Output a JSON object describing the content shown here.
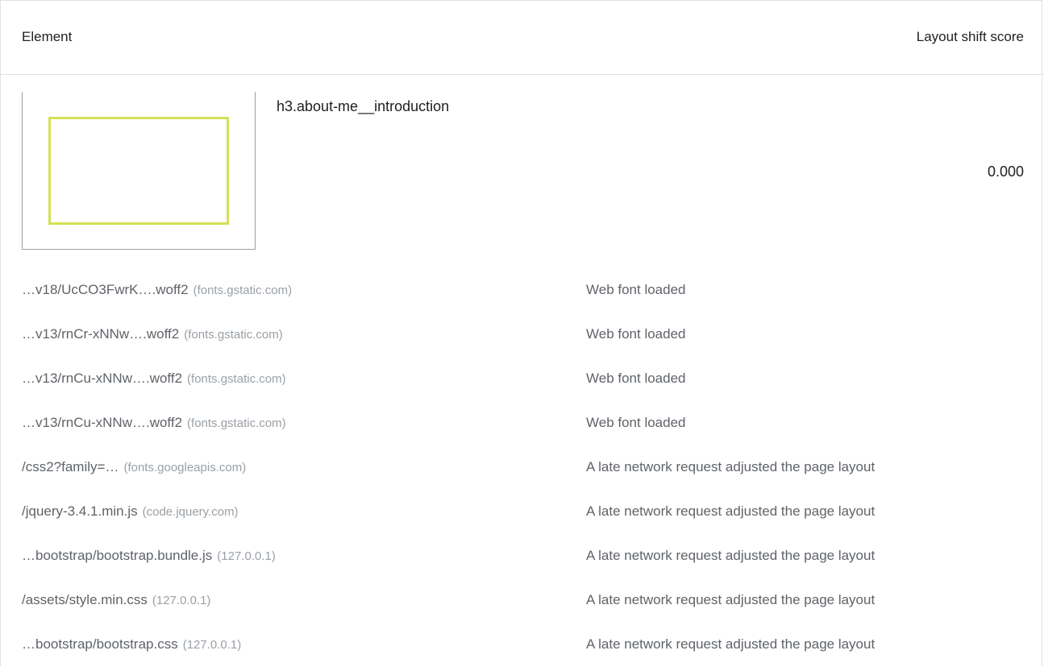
{
  "table": {
    "headers": {
      "element": "Element",
      "score": "Layout shift score"
    },
    "element": {
      "selector": "h3.about-me__introduction",
      "score": "0.000",
      "highlight_color": "#d4e157"
    },
    "sub_items": [
      {
        "url": "…v18/UcCO3FwrK….woff2",
        "host": "(fonts.gstatic.com)",
        "reason": "Web font loaded"
      },
      {
        "url": "…v13/rnCr-xNNw….woff2",
        "host": "(fonts.gstatic.com)",
        "reason": "Web font loaded"
      },
      {
        "url": "…v13/rnCu-xNNw….woff2",
        "host": "(fonts.gstatic.com)",
        "reason": "Web font loaded"
      },
      {
        "url": "…v13/rnCu-xNNw….woff2",
        "host": "(fonts.gstatic.com)",
        "reason": "Web font loaded"
      },
      {
        "url": "/css2?family=…",
        "host": "(fonts.googleapis.com)",
        "reason": "A late network request adjusted the page layout"
      },
      {
        "url": "/jquery-3.4.1.min.js",
        "host": "(code.jquery.com)",
        "reason": "A late network request adjusted the page layout"
      },
      {
        "url": "…bootstrap/bootstrap.bundle.js",
        "host": "(127.0.0.1)",
        "reason": "A late network request adjusted the page layout"
      },
      {
        "url": "/assets/style.min.css",
        "host": "(127.0.0.1)",
        "reason": "A late network request adjusted the page layout"
      },
      {
        "url": "…bootstrap/bootstrap.css",
        "host": "(127.0.0.1)",
        "reason": "A late network request adjusted the page layout"
      }
    ]
  }
}
